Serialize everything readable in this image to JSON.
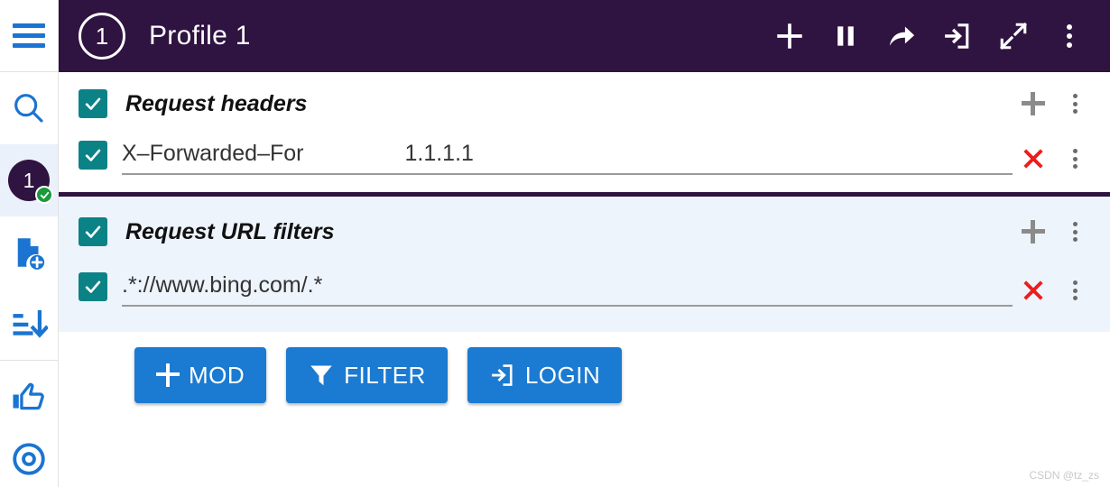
{
  "sidebar": {
    "items": [
      {
        "name": "menu",
        "icon": "hamburger-icon",
        "label": ""
      },
      {
        "name": "search",
        "icon": "search-icon",
        "label": ""
      },
      {
        "name": "profile-1",
        "icon": "profile-badge-icon",
        "label": "1",
        "active": true,
        "status": "enabled"
      },
      {
        "name": "new-file",
        "icon": "file-add-icon",
        "label": ""
      },
      {
        "name": "sort",
        "icon": "sort-descending-icon",
        "label": ""
      },
      {
        "name": "thumbs-up",
        "icon": "thumbs-up-icon",
        "label": ""
      },
      {
        "name": "help",
        "icon": "help-circle-icon",
        "label": ""
      }
    ]
  },
  "titlebar": {
    "badge": "1",
    "title": "Profile 1",
    "actions": [
      {
        "name": "add",
        "icon": "plus-icon"
      },
      {
        "name": "pause",
        "icon": "pause-icon"
      },
      {
        "name": "share",
        "icon": "share-arrow-icon"
      },
      {
        "name": "login",
        "icon": "login-icon"
      },
      {
        "name": "expand",
        "icon": "expand-arrows-icon"
      },
      {
        "name": "more",
        "icon": "more-vertical-icon"
      }
    ]
  },
  "sections": [
    {
      "id": "request-headers",
      "title": "Request headers",
      "checked": true,
      "add_icon": "plus-icon",
      "menu_icon": "more-vertical-icon",
      "rows": [
        {
          "checked": true,
          "name": "X–Forwarded–For",
          "value": "1.1.1.1",
          "delete_icon": "close-x-icon",
          "menu_icon": "more-vertical-icon"
        }
      ]
    },
    {
      "id": "request-url-filters",
      "title": "Request URL filters",
      "checked": true,
      "add_icon": "plus-icon",
      "menu_icon": "more-vertical-icon",
      "rows": [
        {
          "checked": true,
          "name": ".*://www.bing.com/.*",
          "value": "",
          "delete_icon": "close-x-icon",
          "menu_icon": "more-vertical-icon"
        }
      ]
    }
  ],
  "buttons": [
    {
      "name": "mod",
      "label": "MOD",
      "icon": "plus-icon"
    },
    {
      "name": "filter",
      "label": "FILTER",
      "icon": "funnel-icon"
    },
    {
      "name": "login",
      "label": "LOGIN",
      "icon": "login-icon"
    }
  ],
  "watermark": "CSDN @tz_zs",
  "colors": {
    "header_purple": "#2f1340",
    "checkbox_teal": "#0b8286",
    "button_blue": "#1b7ad1",
    "icon_blue": "#1b74d1",
    "delete_red": "#ee1c1c",
    "badge_green": "#1a9a3c",
    "filters_bg": "#eef4fc"
  }
}
